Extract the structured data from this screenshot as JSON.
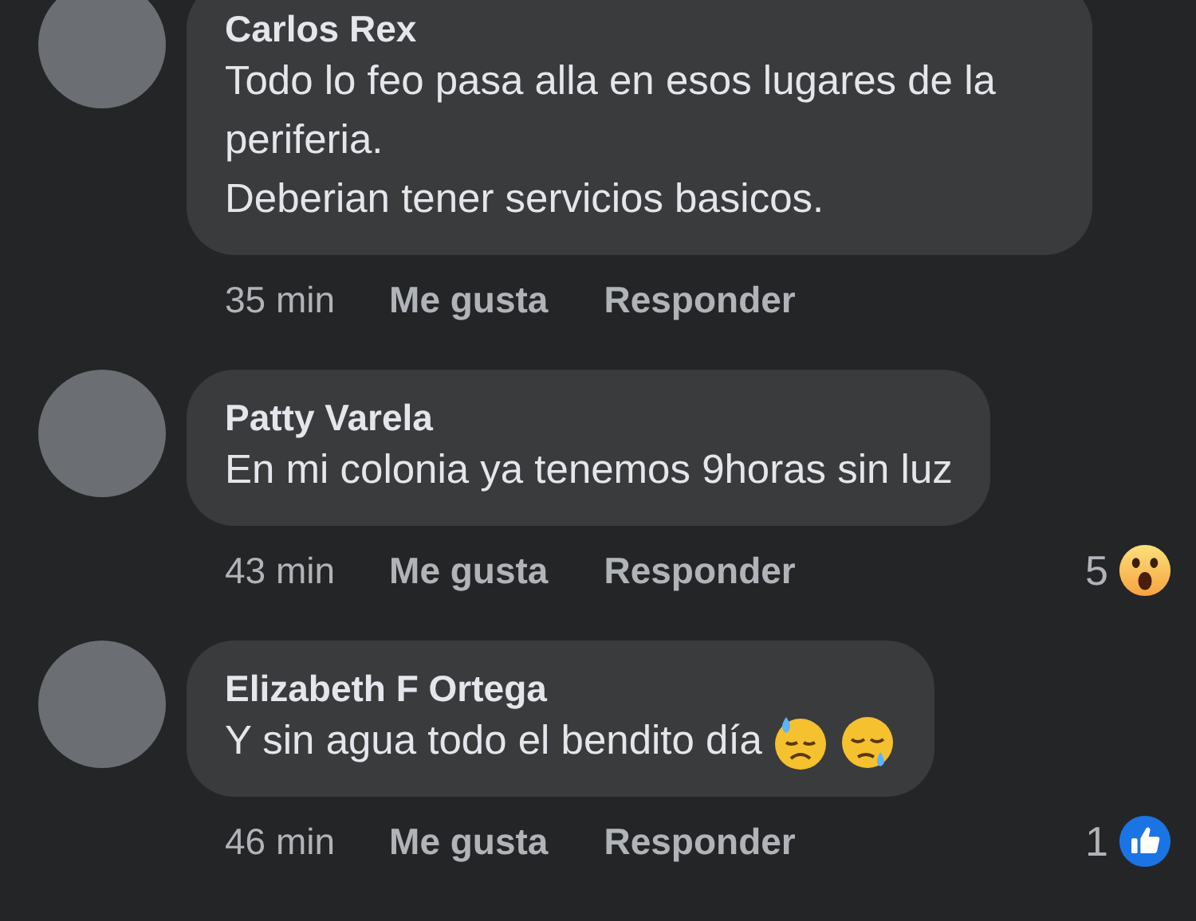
{
  "comments": [
    {
      "author": "Carlos Rex",
      "text": "Todo lo feo pasa alla en esos lugares de la periferia.\nDeberian tener servicios basicos.",
      "time": "35 min",
      "actions": [
        "Me gusta",
        "Responder"
      ]
    },
    {
      "author": "Patty Varela",
      "text": "En mi colonia ya tenemos 9horas sin luz",
      "time": "43 min",
      "actions": [
        "Me gusta",
        "Responder"
      ],
      "reaction": {
        "kind": "wow",
        "count": "5"
      }
    },
    {
      "author": "Elizabeth F Ortega",
      "text": "Y sin agua todo el bendito día",
      "emojis": [
        {
          "kind": "downcast-sweat"
        },
        {
          "kind": "sleepy"
        }
      ],
      "time": "46 min",
      "actions": [
        "Me gusta",
        "Responder"
      ],
      "reaction": {
        "kind": "like",
        "count": "1"
      }
    }
  ]
}
